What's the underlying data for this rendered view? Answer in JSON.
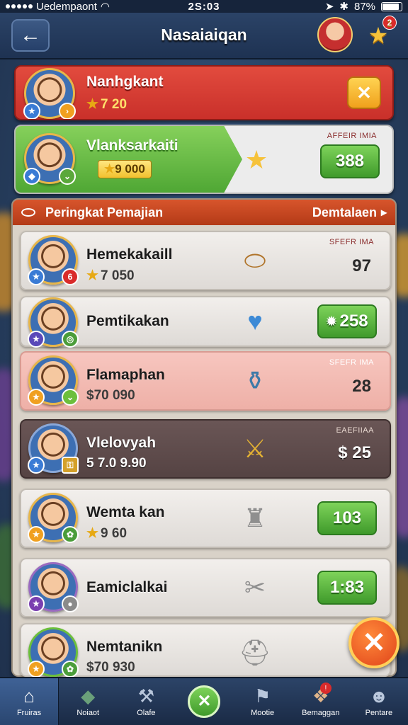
{
  "status": {
    "carrier": "Uedempaont",
    "time": "2S:03",
    "battery": "87%",
    "battery_level": 0.87
  },
  "header": {
    "title": "Nasaiaiqan",
    "back_icon": "back-arrow-icon",
    "notif_count": "2"
  },
  "top_cards": {
    "first": {
      "name": "Nanhgkant",
      "score": "7 20"
    },
    "second": {
      "name": "Vlanksarkaiti",
      "score": "9 000",
      "label": "AFFEIR IMIA",
      "value": "388"
    }
  },
  "panel": {
    "title": "Peringkat Pemajian",
    "right": "Demtalaen",
    "rows": [
      {
        "name": "Hemekakaill",
        "score": "7 050",
        "label": "SFEFR IMA",
        "value": "97",
        "badge": "6"
      },
      {
        "name": "Pemtikakan",
        "score": "",
        "label": "",
        "value": "258"
      },
      {
        "name": "Flamaphan",
        "score": "$70 090",
        "label": "SFEFR IMA",
        "value": "28"
      },
      {
        "name": "Vlelovyah",
        "score": "5 7.0 9.90",
        "label": "EAEFIIAA",
        "value": "$ 25"
      },
      {
        "name": "Wemta kan",
        "score": "9 60",
        "label": "",
        "value": "103"
      },
      {
        "name": "Eamiclalkai",
        "score": "",
        "label": "",
        "value": "1:83"
      },
      {
        "name": "Nemtanikn",
        "score": "$70 930",
        "label": "",
        "value": ""
      }
    ]
  },
  "nav": {
    "items": [
      {
        "label": "Fruiras"
      },
      {
        "label": "Noiaot"
      },
      {
        "label": "Olafe"
      },
      {
        "label": ""
      },
      {
        "label": "Mootie"
      },
      {
        "label": "Bemaggan"
      },
      {
        "label": "Pentare"
      }
    ]
  }
}
